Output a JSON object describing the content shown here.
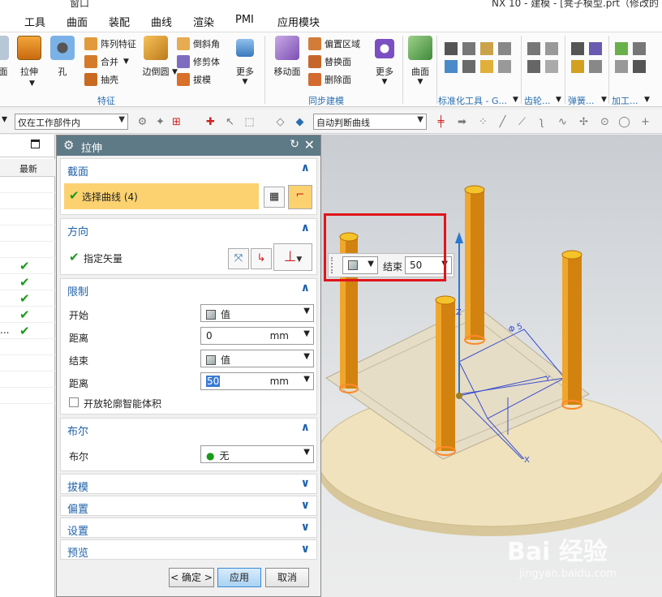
{
  "titlebar": {
    "left_text": "窗口",
    "right_text": "NX 10 - 建模 - [凳子模型.prt（修改的"
  },
  "menu": [
    "工具",
    "曲面",
    "装配",
    "曲线",
    "渲染",
    "PMI",
    "应用模块"
  ],
  "ribbon": {
    "feature_group": {
      "label": "特征",
      "big": [
        "拉伸",
        "孔",
        "边倒圆",
        "更多"
      ],
      "left_partial": "面",
      "small": [
        "阵列特征",
        "合并",
        "抽壳",
        "倒斜角",
        "修剪体",
        "拔模"
      ]
    },
    "sync_group": {
      "label": "同步建模",
      "big": [
        "移动面",
        "更多"
      ],
      "small": [
        "偏置区域",
        "替换面",
        "删除面"
      ]
    },
    "surface": "曲面",
    "other_labels": [
      "标准化工具 - G...",
      "齿轮...",
      "弹簧...",
      "加工..."
    ]
  },
  "toolbar2": {
    "scope": "仅在工作部件内",
    "curve_rule": "自动判断曲线"
  },
  "navigator": {
    "column_header": "最新",
    "dots": "..."
  },
  "dialog": {
    "title": "拉伸",
    "section_label": "截面",
    "select_curve": "选择曲线 (4)",
    "direction_label": "方向",
    "specify_vector": "指定矢量",
    "limits_label": "限制",
    "start_label": "开始",
    "start_value": "值",
    "distance_label": "距离",
    "start_distance": "0",
    "unit": "mm",
    "end_label": "结束",
    "end_value": "值",
    "end_distance": "50",
    "open_profile": "开放轮廓智能体积",
    "boolean_label": "布尔",
    "boolean_row": "布尔",
    "boolean_value": "无",
    "collapsed": [
      "拔模",
      "偏置",
      "设置",
      "预览"
    ],
    "ok": "< 确定 >",
    "apply": "应用",
    "cancel": "取消"
  },
  "hud": {
    "label": "结束",
    "value": "50"
  },
  "viewport": {
    "axis_z": "Z",
    "axis_y": "Y",
    "axis_x": "X",
    "dim_text": "Φ 5"
  },
  "watermark": {
    "brand": "Bai 经验",
    "url": "jingyan.baidu.com"
  }
}
